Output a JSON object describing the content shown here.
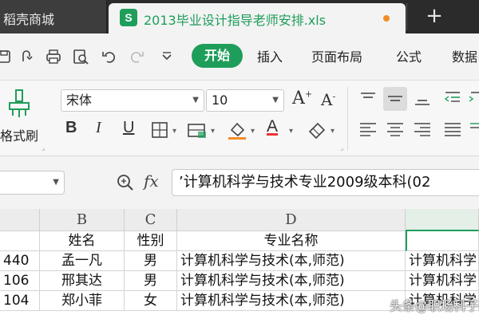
{
  "tabs": {
    "inactive_label": "稻壳商城",
    "active_label": "2013毕业设计指导老师安排.xls",
    "file_badge": "S",
    "new_tab": "+"
  },
  "menu": {
    "home": "开始",
    "insert": "插入",
    "layout": "页面布局",
    "formula": "公式",
    "data": "数据"
  },
  "ribbon": {
    "format_painter": "格式刷",
    "font_name": "宋体",
    "font_size": "10",
    "grow_font": "A",
    "shrink_font": "A",
    "bold": "B",
    "italic": "I",
    "underline": "U",
    "font_color": "A"
  },
  "formula_bar": {
    "fx": "fx",
    "value": "’计算机科学与技术专业2009级本科(02"
  },
  "sheet": {
    "columns": [
      "B",
      "C",
      "D"
    ],
    "header_row": [
      "姓名",
      "性别",
      "专业名称"
    ],
    "rows": [
      {
        "a": "440",
        "b": "孟一凡",
        "c": "男",
        "d": "计算机科学与技术(本,师范)",
        "e": "计算机科学"
      },
      {
        "a": "106",
        "b": "邢其达",
        "c": "男",
        "d": "计算机科学与技术(本,师范)",
        "e": "计算机科学"
      },
      {
        "a": "104",
        "b": "郑小菲",
        "c": "女",
        "d": "计算机科学与技术(本,师范)",
        "e": "计算机科学"
      }
    ]
  },
  "watermark": "头条@职场科子",
  "colors": {
    "accent": "#1e9e5a",
    "tab_dot": "#f28c28",
    "tab_bar": "#2b2b2b"
  }
}
